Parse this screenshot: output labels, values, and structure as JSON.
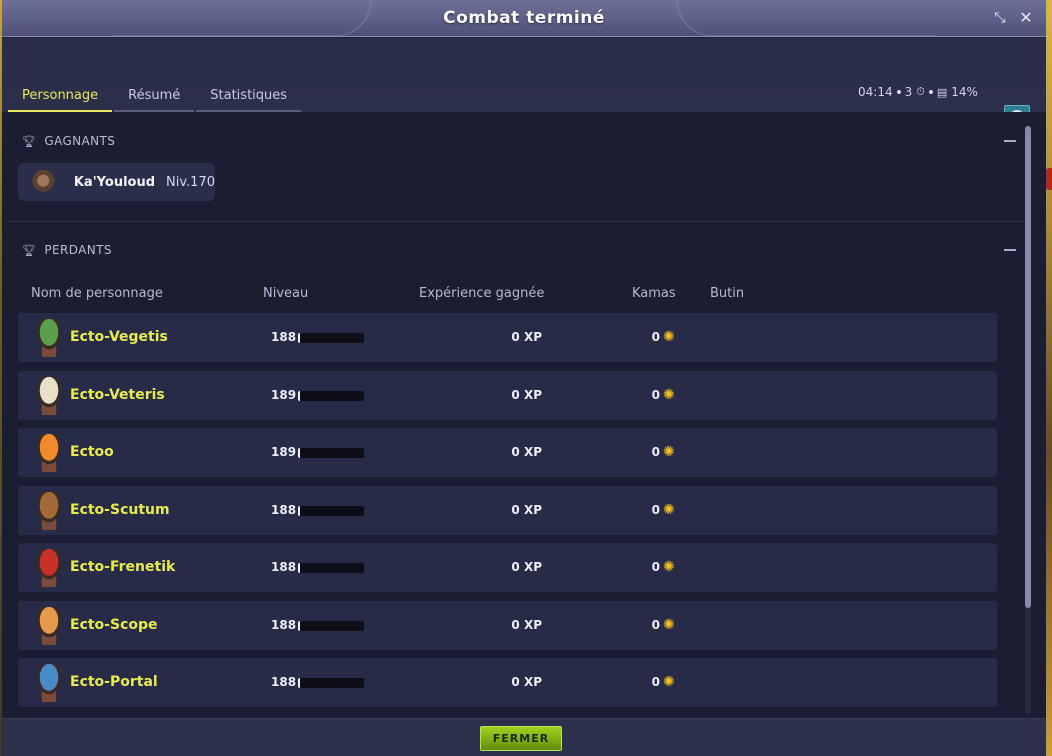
{
  "window": {
    "title": "Combat terminé"
  },
  "tabs": [
    {
      "label": "Personnage",
      "active": true
    },
    {
      "label": "Résumé",
      "active": false
    },
    {
      "label": "Statistiques",
      "active": false
    }
  ],
  "stats": {
    "duration": "04:14",
    "turns": "3",
    "percent": "14%",
    "turn_icon": "stopwatch-icon",
    "percent_icon": "treasure-chest-icon"
  },
  "winners": {
    "heading": "GAGNANTS",
    "items": [
      {
        "name": "Ka'Youloud",
        "level": "Niv.170"
      }
    ]
  },
  "losers": {
    "heading": "PERDANTS",
    "columns": {
      "name": "Nom de personnage",
      "level": "Niveau",
      "xp": "Expérience gagnée",
      "kamas": "Kamas",
      "loot": "Butin"
    },
    "rows": [
      {
        "name": "Ecto-Vegetis",
        "level": "188",
        "xp": "0 XP",
        "kamas": "0",
        "xp_progress": 0.03,
        "avatar_color": "#5aa04a"
      },
      {
        "name": "Ecto-Veteris",
        "level": "189",
        "xp": "0 XP",
        "kamas": "0",
        "xp_progress": 0.03,
        "avatar_color": "#e8e0c8"
      },
      {
        "name": "Ectoo",
        "level": "189",
        "xp": "0 XP",
        "kamas": "0",
        "xp_progress": 0.03,
        "avatar_color": "#f08a2a"
      },
      {
        "name": "Ecto-Scutum",
        "level": "188",
        "xp": "0 XP",
        "kamas": "0",
        "xp_progress": 0.03,
        "avatar_color": "#a06a3a"
      },
      {
        "name": "Ecto-Frenetik",
        "level": "188",
        "xp": "0 XP",
        "kamas": "0",
        "xp_progress": 0.03,
        "avatar_color": "#c8302a"
      },
      {
        "name": "Ecto-Scope",
        "level": "188",
        "xp": "0 XP",
        "kamas": "0",
        "xp_progress": 0.03,
        "avatar_color": "#e89a4a"
      },
      {
        "name": "Ecto-Portal",
        "level": "188",
        "xp": "0 XP",
        "kamas": "0",
        "xp_progress": 0.03,
        "avatar_color": "#4a8ac8"
      }
    ]
  },
  "footer": {
    "close_label": "FERMER"
  },
  "colors": {
    "accent_yellow": "#e7ea5a",
    "button_green": "#8fc01b",
    "kama_gold": "#f2c01c"
  }
}
